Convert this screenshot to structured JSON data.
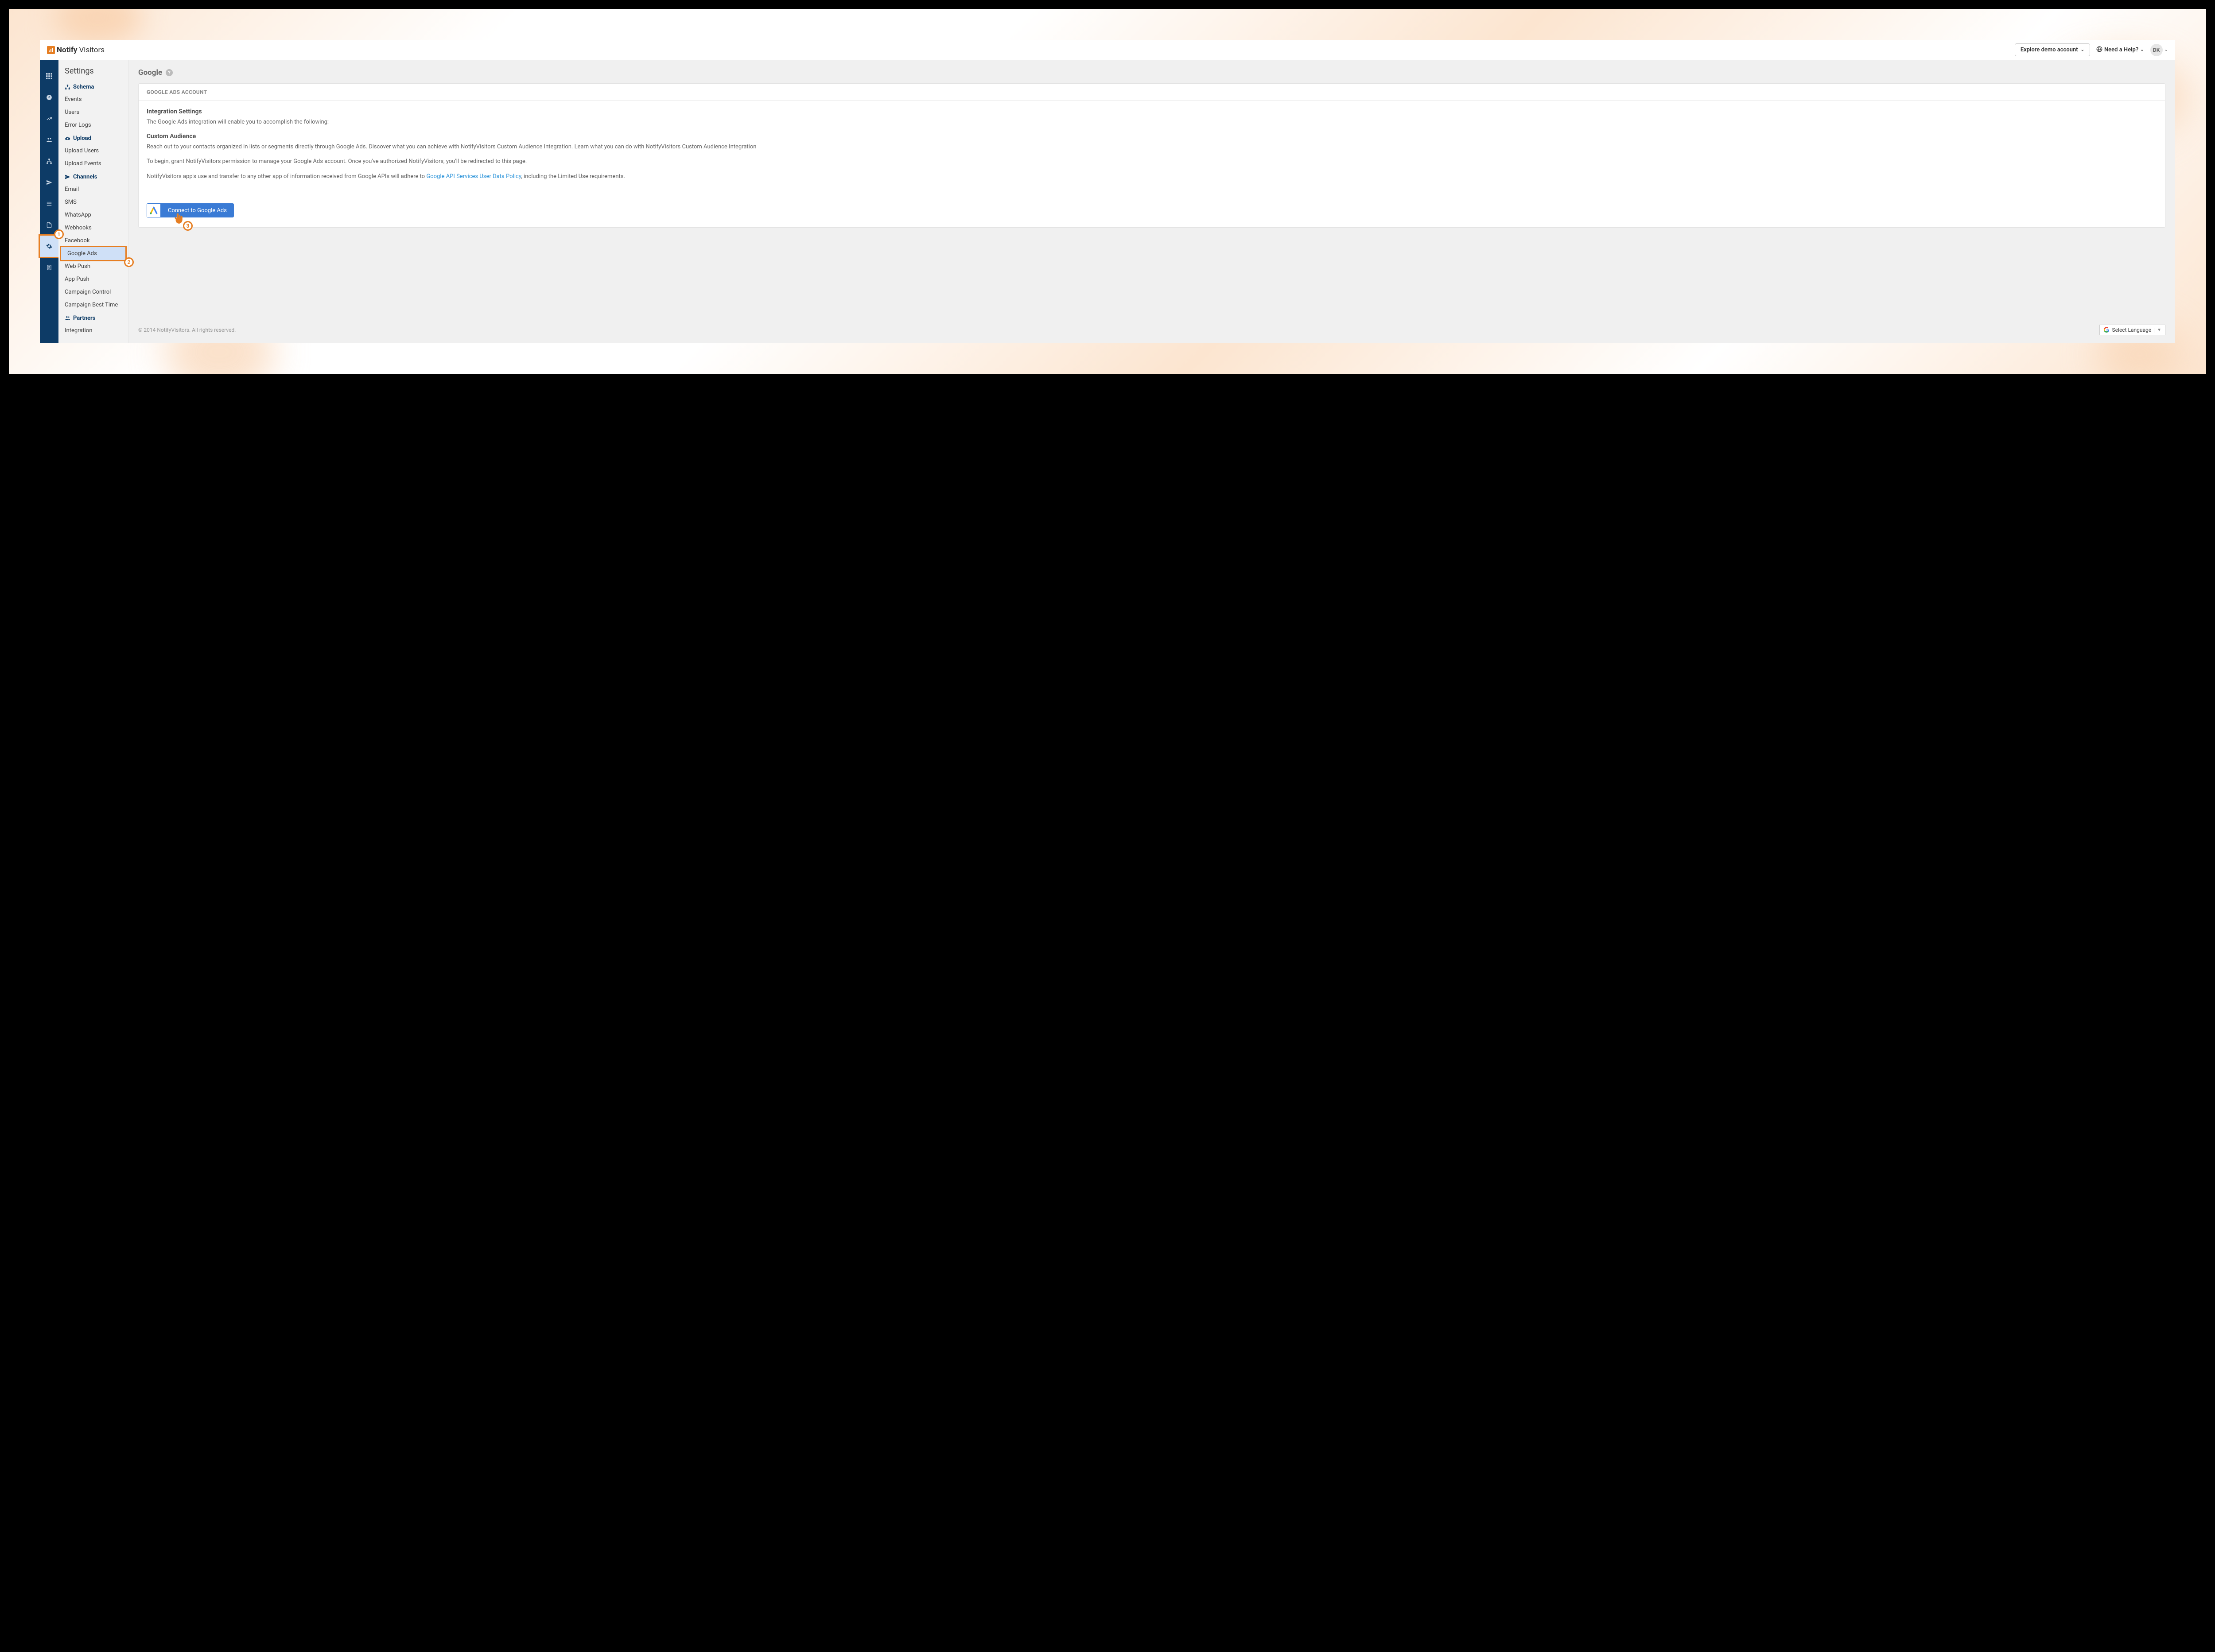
{
  "topbar": {
    "logo_bold": "Notify",
    "logo_light": "Visitors",
    "explore_label": "Explore demo account",
    "help_label": "Need a Help?",
    "avatar_initials": "DK"
  },
  "sidebar": {
    "title": "Settings",
    "sections": [
      {
        "label": "Schema",
        "items": [
          "Events",
          "Users",
          "Error Logs"
        ]
      },
      {
        "label": "Upload",
        "items": [
          "Upload Users",
          "Upload Events"
        ]
      },
      {
        "label": "Channels",
        "items": [
          "Email",
          "SMS",
          "WhatsApp",
          "Webhooks",
          "Facebook",
          "Google Ads",
          "Web Push",
          "App Push",
          "Campaign Control",
          "Campaign Best Time"
        ]
      },
      {
        "label": "Partners",
        "items": [
          "Integration"
        ]
      }
    ],
    "active_item": "Google Ads"
  },
  "callouts": [
    "1",
    "2",
    "3"
  ],
  "main": {
    "page_title": "Google",
    "card_header": "GOOGLE ADS ACCOUNT",
    "h_integration": "Integration Settings",
    "p_intro": "The Google Ads integration will enable you to accomplish the following:",
    "h_custom": "Custom Audience",
    "p_custom": "Reach out to your contacts organized in lists or segments directly through Google Ads. Discover what you can achieve with NotifyVisitors Custom Audience Integration. Learn what you can do with NotifyVisitors Custom Audience Integration",
    "p_begin": "To begin, grant NotifyVisitors permission to manage your Google Ads account. Once you've authorized NotifyVisitors, you'll be redirected to this page.",
    "p_policy_pre": "NotifyVisitors app's use and transfer to any other app of information received from Google APIs will adhere to ",
    "p_policy_link": "Google API Services User Data Policy",
    "p_policy_post": ", including the Limited Use requirements.",
    "connect_label": "Connect to Google Ads"
  },
  "footer": {
    "copyright": "© 2014 NotifyVisitors. All rights reserved.",
    "lang_label": "Select Language"
  }
}
